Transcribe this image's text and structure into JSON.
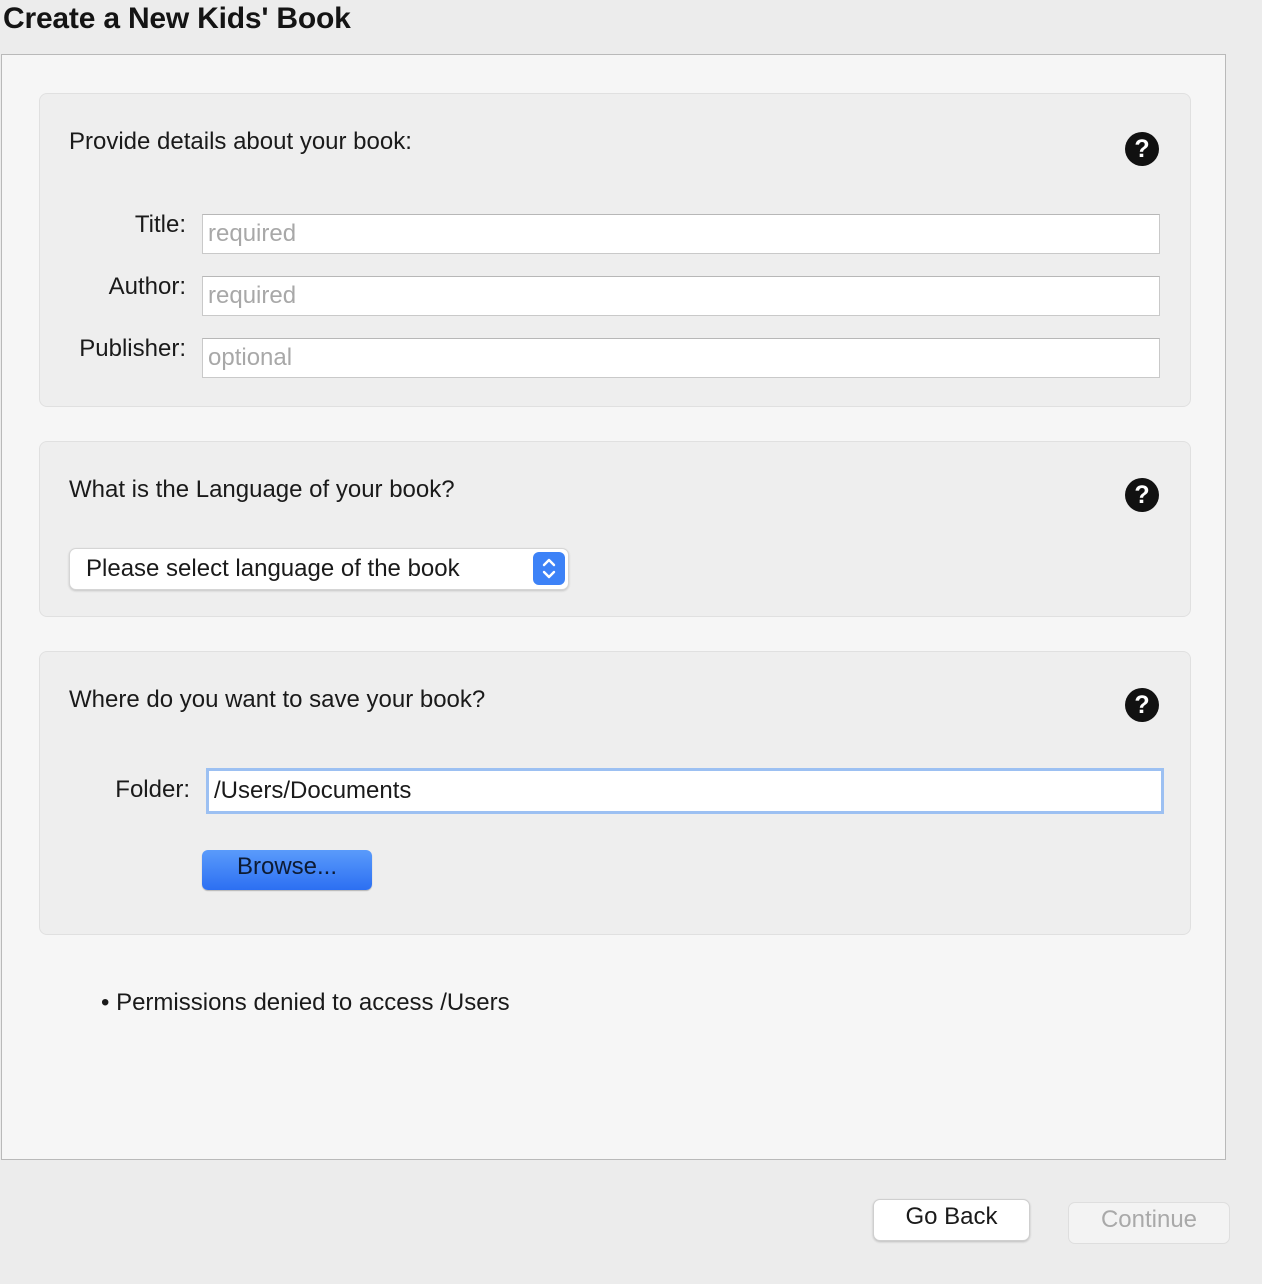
{
  "window": {
    "title": "Create a New Kids' Book"
  },
  "details_panel": {
    "heading": "Provide details about your book:",
    "help_icon": "question-circle-icon",
    "fields": [
      {
        "label": "Title:",
        "value": "",
        "placeholder": "required"
      },
      {
        "label": "Author:",
        "value": "",
        "placeholder": "required"
      },
      {
        "label": "Publisher:",
        "value": "",
        "placeholder": "optional"
      }
    ]
  },
  "language_panel": {
    "heading": "What is the Language of your book?",
    "help_icon": "question-circle-icon",
    "select": {
      "selected": "Please select language of the book",
      "icon": "chevron-up-down-icon"
    }
  },
  "save_panel": {
    "heading": "Where do you want to save your book?",
    "help_icon": "question-circle-icon",
    "folder_label": "Folder:",
    "folder_value": "/Users/Documents",
    "browse_label": "Browse..."
  },
  "messages": {
    "permission": "• Permissions denied to access /Users"
  },
  "footer": {
    "back_label": "Go Back",
    "continue_label": "Continue"
  },
  "colors": {
    "accent": "#3d82f7",
    "focus_ring": "#9cc0f2",
    "disabled_text": "#a9a9a9"
  }
}
